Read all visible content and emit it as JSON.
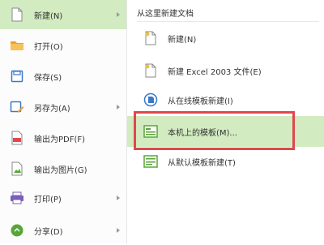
{
  "menu": {
    "items": [
      {
        "label": "新建(N)",
        "icon": "new-doc-icon",
        "has_arrow": true,
        "active": true
      },
      {
        "label": "打开(O)",
        "icon": "folder-icon",
        "has_arrow": false
      },
      {
        "label": "保存(S)",
        "icon": "save-icon",
        "has_arrow": false
      },
      {
        "label": "另存为(A)",
        "icon": "save-as-icon",
        "has_arrow": true
      },
      {
        "label": "输出为PDF(F)",
        "icon": "pdf-icon",
        "has_arrow": false
      },
      {
        "label": "输出为图片(G)",
        "icon": "image-export-icon",
        "has_arrow": false
      },
      {
        "label": "打印(P)",
        "icon": "printer-icon",
        "has_arrow": true
      },
      {
        "label": "分享(D)",
        "icon": "share-icon",
        "has_arrow": true
      }
    ]
  },
  "submenu": {
    "header": "从这里新建文档",
    "items": [
      {
        "label": "新建(N)",
        "icon": "new-doc-icon"
      },
      {
        "label": "新建 Excel 2003 文件(E)",
        "icon": "new-excel-icon"
      },
      {
        "label": "从在线模板新建(I)",
        "icon": "online-template-icon"
      },
      {
        "label": "本机上的模板(M)...",
        "icon": "local-template-icon",
        "active": true
      },
      {
        "label": "从默认模板新建(T)",
        "icon": "default-template-icon"
      }
    ]
  },
  "colors": {
    "active_bg": "#d2ebc1",
    "highlight_border": "#e0474c",
    "green": "#59a53a",
    "orange": "#f0a030",
    "blue": "#3a78c8"
  }
}
